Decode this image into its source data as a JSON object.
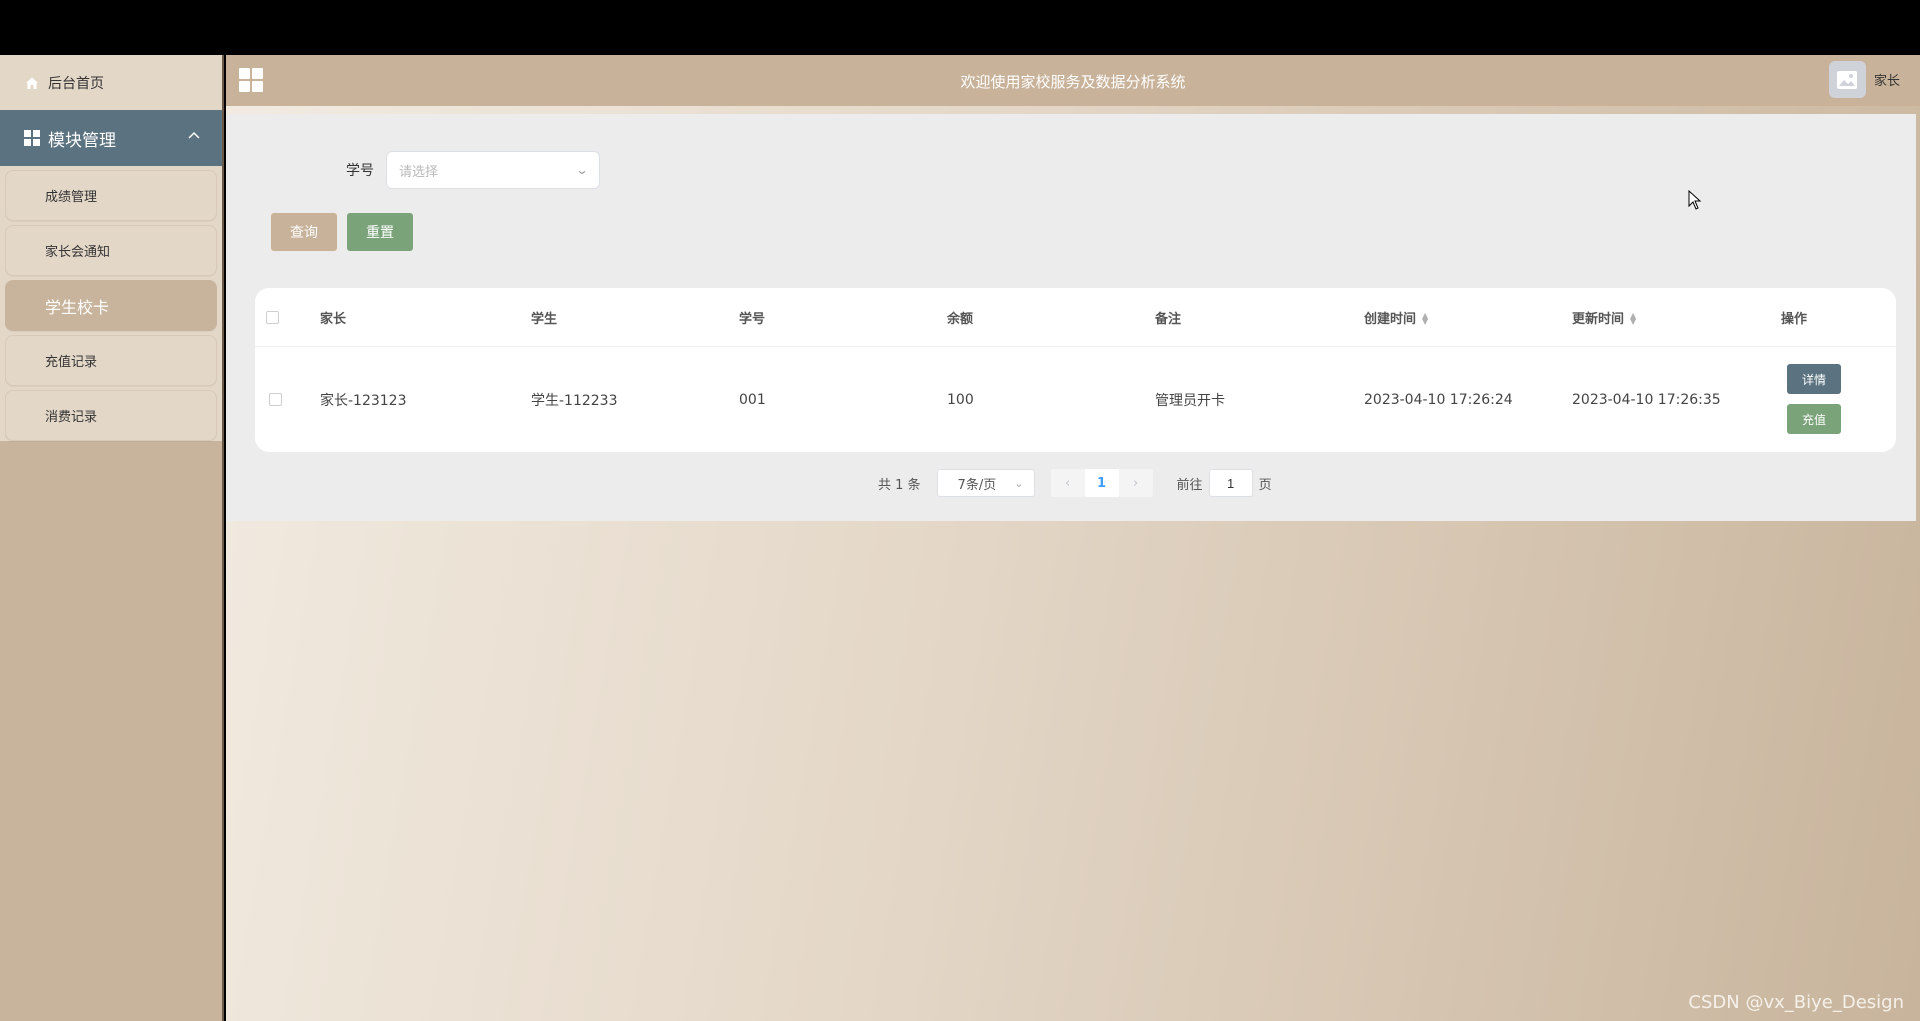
{
  "sidebar": {
    "home_label": "后台首页",
    "module_label": "模块管理",
    "items": [
      {
        "label": "成绩管理"
      },
      {
        "label": "家长会通知"
      },
      {
        "label": "学生校卡"
      },
      {
        "label": "充值记录"
      },
      {
        "label": "消费记录"
      }
    ],
    "active_index": 2
  },
  "header": {
    "title": "欢迎使用家校服务及数据分析系统",
    "user_name": "家长"
  },
  "filter": {
    "label": "学号",
    "placeholder": "请选择"
  },
  "buttons": {
    "query": "查询",
    "reset": "重置"
  },
  "table": {
    "columns": [
      "家长",
      "学生",
      "学号",
      "余额",
      "备注",
      "创建时间",
      "更新时间",
      "操作"
    ],
    "sortable_columns": [
      "创建时间",
      "更新时间"
    ],
    "rows": [
      {
        "parent": "家长-123123",
        "student": "学生-112233",
        "student_no": "001",
        "balance": "100",
        "remark": "管理员开卡",
        "created_at": "2023-04-10 17:26:24",
        "updated_at": "2023-04-10 17:26:35",
        "actions": [
          "详情",
          "充值"
        ]
      }
    ]
  },
  "pagination": {
    "total": "共 1 条",
    "page_size": "7条/页",
    "current_page": "1",
    "goto_prefix": "前往",
    "goto_value": "1",
    "goto_suffix": "页"
  },
  "watermark": "CSDN @vx_Biye_Design",
  "colors": {
    "sidebar_bg": "#c8b49c",
    "module_head": "#5b7280",
    "query_btn": "#c8b29a",
    "reset_btn": "#7aa37a",
    "detail_btn": "#5b7280"
  }
}
